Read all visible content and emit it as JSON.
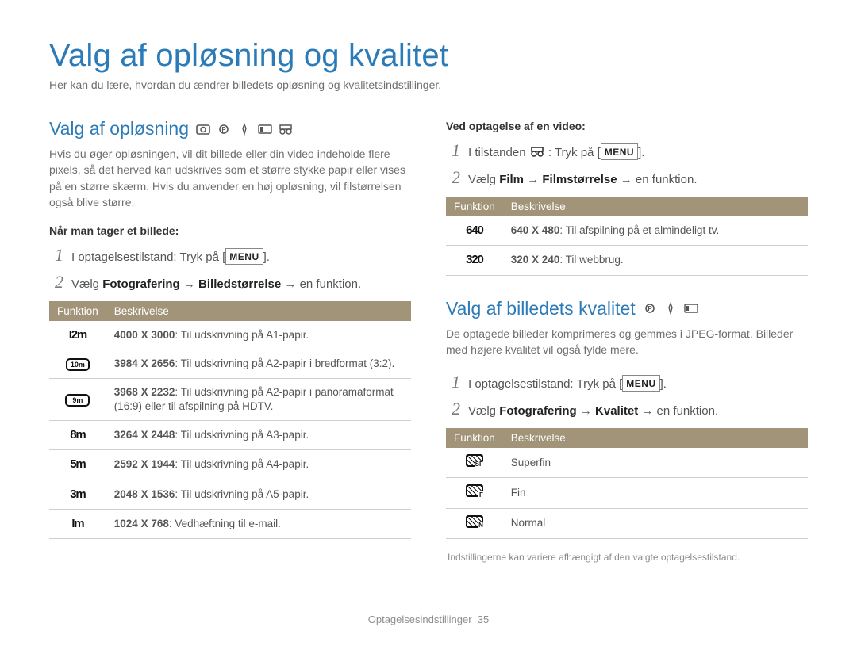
{
  "page": {
    "title": "Valg af opløsning og kvalitet",
    "intro": "Her kan du lære, hvordan du ændrer billedets opløsning og kvalitetsindstillinger."
  },
  "section_resolution": {
    "heading": "Valg af opløsning",
    "body": "Hvis du øger opløsningen, vil dit billede eller din video indeholde flere pixels, så det herved kan udskrives som et større stykke papir eller vises på en større skærm. Hvis du anvender en høj opløsning, vil filstørrelsen også blive større.",
    "photo_label": "Når man tager et billede:",
    "photo_step1": {
      "num": "1",
      "text_before": "I optagelsestilstand: Tryk på [",
      "menu": "MENU",
      "text_after": "]."
    },
    "photo_step2": {
      "num": "2",
      "prefix": "Vælg ",
      "b1": "Fotografering",
      "arrow1": " → ",
      "b2": "Billedstørrelse",
      "suffix": " → en funktion."
    },
    "photo_table": {
      "h1": "Funktion",
      "h2": "Beskrivelse",
      "rows": [
        {
          "icon": "12m",
          "bold": "4000 X 3000",
          "desc": ": Til udskrivning på A1-papir."
        },
        {
          "icon": "10m_box",
          "bold": "3984 X 2656",
          "desc": ": Til udskrivning på A2-papir i bredformat (3:2)."
        },
        {
          "icon": "9m_box",
          "bold": "3968 X 2232",
          "desc": ": Til udskrivning på A2-papir i panoramaformat (16:9) eller til afspilning på HDTV."
        },
        {
          "icon": "8m",
          "bold": "3264 X 2448",
          "desc": ": Til udskrivning på A3-papir."
        },
        {
          "icon": "5m",
          "bold": "2592 X 1944",
          "desc": ": Til udskrivning på A4-papir."
        },
        {
          "icon": "3m",
          "bold": "2048 X 1536",
          "desc": ": Til udskrivning på A5-papir."
        },
        {
          "icon": "1m",
          "bold": "1024 X 768",
          "desc": ": Vedhæftning til e-mail."
        }
      ]
    },
    "video_label": "Ved optagelse af en video:",
    "video_step1": {
      "num": "1",
      "text_before": "I tilstanden ",
      "text_after": " : Tryk på [",
      "menu": "MENU",
      "close": "]."
    },
    "video_step2": {
      "num": "2",
      "prefix": "Vælg ",
      "b1": "Film",
      "arrow1": " → ",
      "b2": "Filmstørrelse",
      "suffix": " → en funktion."
    },
    "video_table": {
      "h1": "Funktion",
      "h2": "Beskrivelse",
      "rows": [
        {
          "icon": "640",
          "bold": "640 X 480",
          "desc": ": Til afspilning på et almindeligt tv."
        },
        {
          "icon": "320",
          "bold": "320 X 240",
          "desc": ": Til webbrug."
        }
      ]
    }
  },
  "section_quality": {
    "heading": "Valg af billedets kvalitet",
    "body": "De optagede billeder komprimeres og gemmes i JPEG-format. Billeder med højere kvalitet vil også fylde mere.",
    "step1": {
      "num": "1",
      "text_before": "I optagelsestilstand: Tryk på [",
      "menu": "MENU",
      "text_after": "]."
    },
    "step2": {
      "num": "2",
      "prefix": "Vælg ",
      "b1": "Fotografering",
      "arrow1": " → ",
      "b2": "Kvalitet",
      "suffix": " → en funktion."
    },
    "table": {
      "h1": "Funktion",
      "h2": "Beskrivelse",
      "rows": [
        {
          "sub": "SF",
          "label": "Superfin"
        },
        {
          "sub": "F",
          "label": "Fin"
        },
        {
          "sub": "N",
          "label": "Normal"
        }
      ]
    },
    "footnote": "Indstillingerne kan variere afhængigt af den valgte optagelsestilstand."
  },
  "footer": {
    "section": "Optagelsesindstillinger",
    "page": "35"
  }
}
